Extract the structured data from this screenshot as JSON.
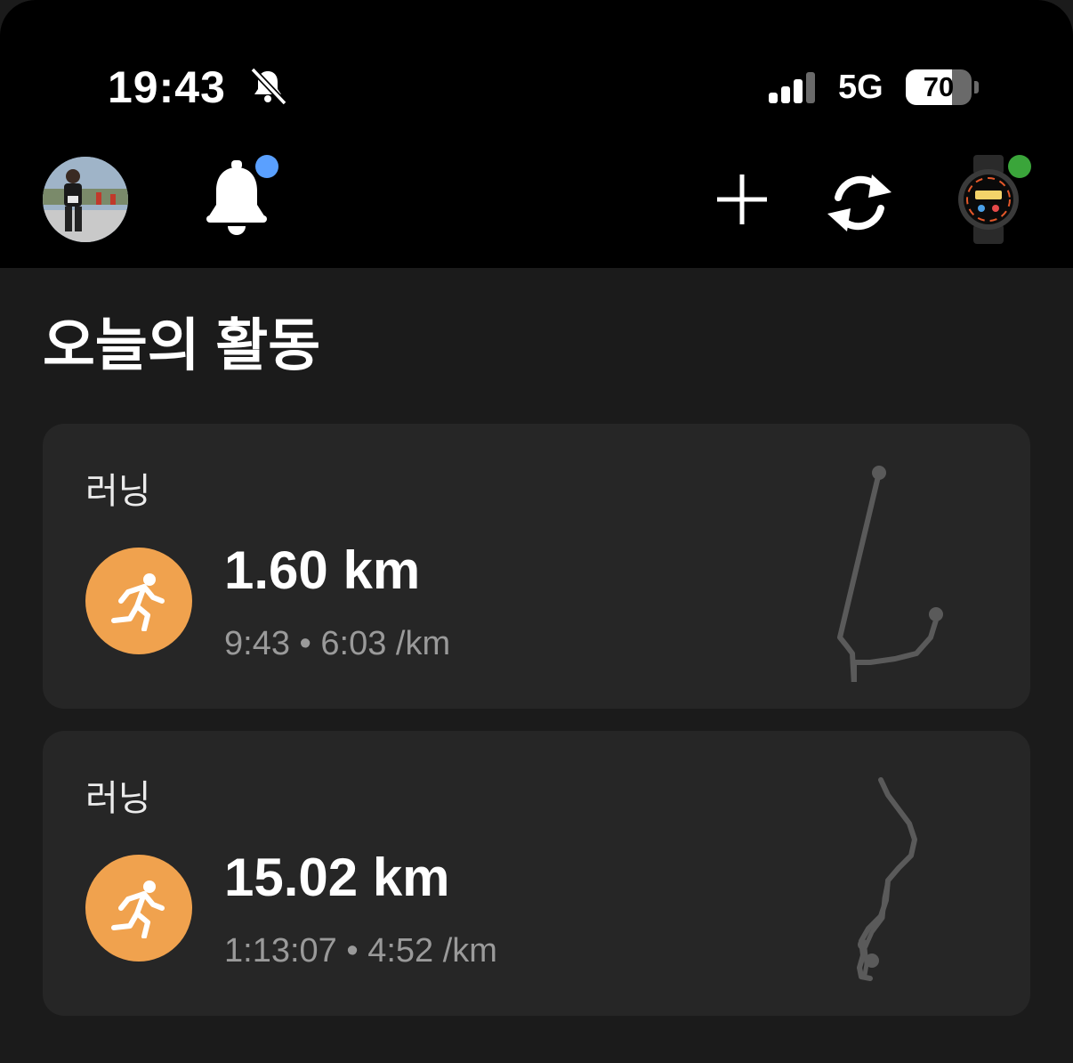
{
  "status_bar": {
    "time": "19:43",
    "network": "5G",
    "battery": {
      "level": 70,
      "label": "70"
    }
  },
  "toolbar": {
    "avatar_icon": "profile-avatar",
    "notification_icon": "bell-icon",
    "add_icon": "plus-icon",
    "sync_icon": "sync-icon",
    "device_icon": "watch-icon"
  },
  "section": {
    "title": "오늘의 활동"
  },
  "activities": [
    {
      "type": "러닝",
      "distance": "1.60 km",
      "duration": "9:43",
      "separator": "•",
      "pace": "6:03 /km"
    },
    {
      "type": "러닝",
      "distance": "15.02 km",
      "duration": "1:13:07",
      "separator": "•",
      "pace": "4:52 /km"
    }
  ],
  "colors": {
    "background": "#1b1b1b",
    "card": "#262626",
    "activity_accent": "#f0a24e",
    "notification_dot": "#5aa0ff",
    "device_connected_dot": "#3aa53a",
    "route_line": "#5a5a5a"
  }
}
